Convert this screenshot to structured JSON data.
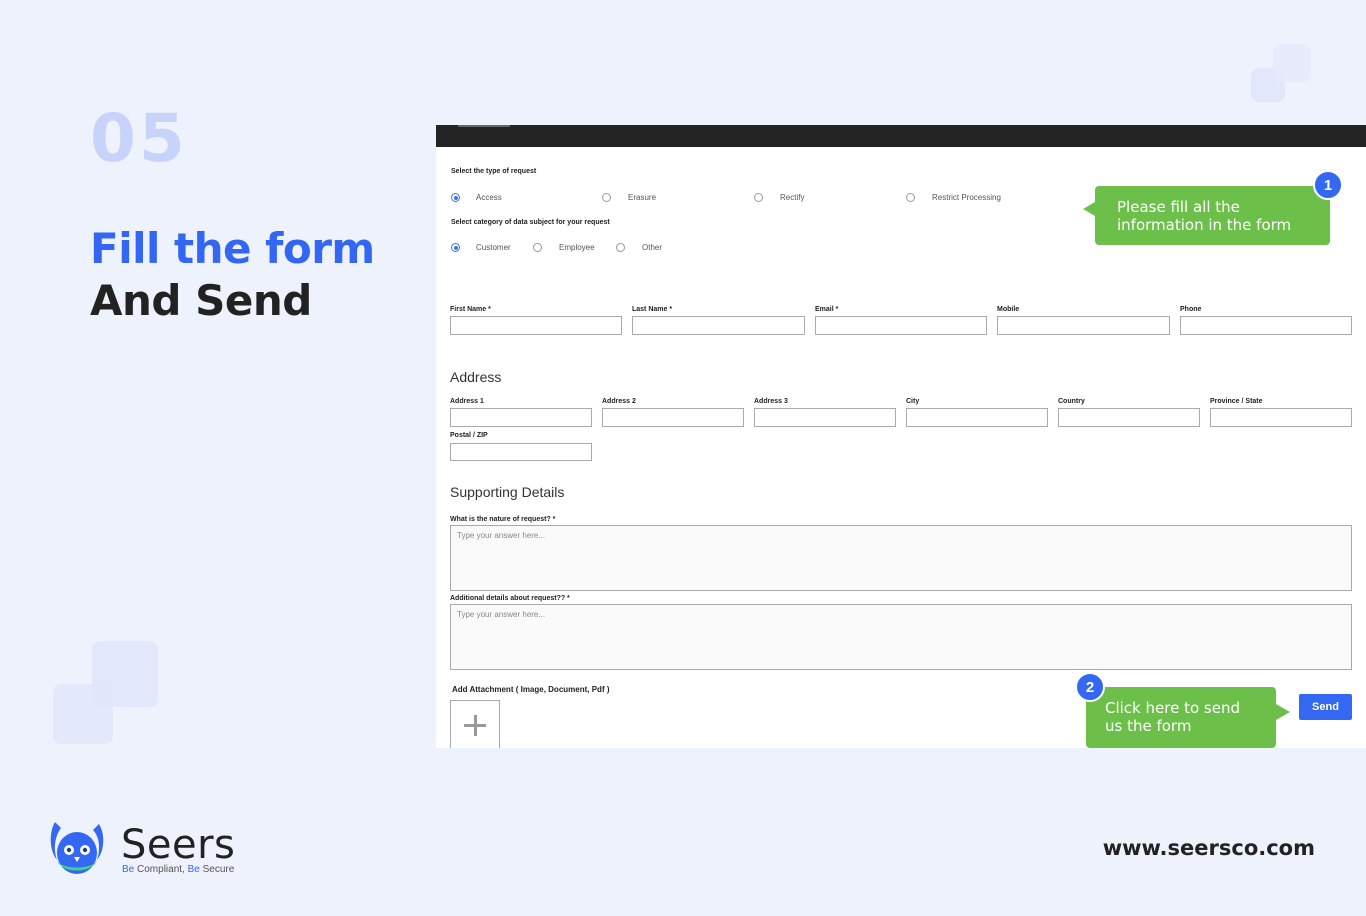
{
  "slide": {
    "step_number": "05",
    "headline_line1": "Fill the form",
    "headline_line2": "And Send"
  },
  "form": {
    "request_type": {
      "label": "Select the type of request",
      "options": [
        "Access",
        "Erasure",
        "Rectify",
        "Restrict Processing"
      ],
      "selected": "Access"
    },
    "subject_category": {
      "label": "Select category of data subject for your request",
      "options": [
        "Customer",
        "Employee",
        "Other"
      ],
      "selected": "Customer"
    },
    "personal_fields": [
      "First Name *",
      "Last Name *",
      "Email *",
      "Mobile",
      "Phone"
    ],
    "address": {
      "title": "Address",
      "fields": [
        "Address 1",
        "Address 2",
        "Address 3",
        "City",
        "Country",
        "Province / State"
      ],
      "postal_label": "Postal / ZIP"
    },
    "supporting": {
      "title": "Supporting Details",
      "nature_label": "What is the nature of request? *",
      "nature_placeholder": "Type your answer here...",
      "additional_label": "Additional details about request?? *",
      "additional_placeholder": "Type your answer here..."
    },
    "attachment_label": "Add Attachment ( Image, Document, Pdf )",
    "send_label": "Send"
  },
  "callouts": {
    "one": {
      "badge": "1",
      "text": "Please fill all the information in the form"
    },
    "two": {
      "badge": "2",
      "text": "Click here to send us the form"
    }
  },
  "brand": {
    "name": "Seers",
    "tagline_part1": "Be",
    "tagline_part2": "Compliant,",
    "tagline_part3": "Be",
    "tagline_part4": "Secure",
    "website": "www.seersco.com"
  },
  "colors": {
    "accent": "#3468f3",
    "callout": "#6cc04a",
    "background": "#eef2fc"
  }
}
